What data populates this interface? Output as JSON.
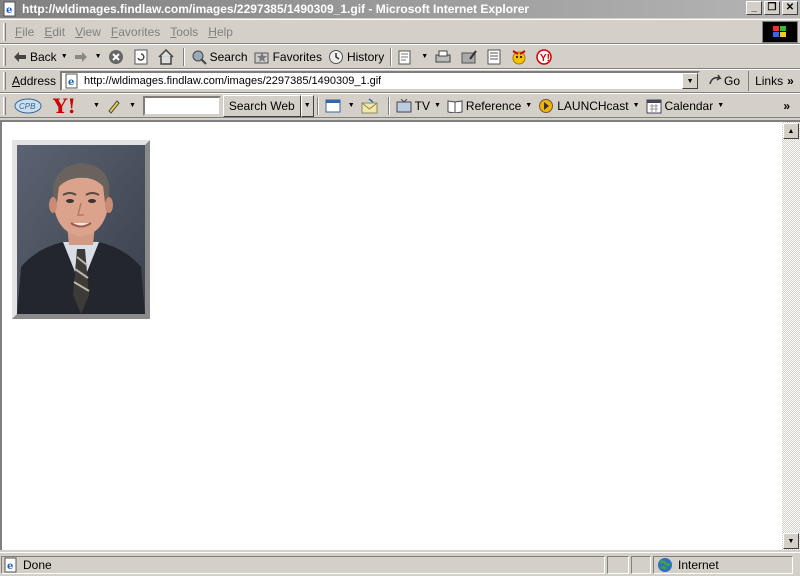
{
  "window": {
    "title": "http://wldimages.findlaw.com/images/2297385/1490309_1.gif - Microsoft Internet Explorer",
    "minimize": "_",
    "maximize": "❐",
    "close": "✕"
  },
  "menu": {
    "items": [
      "File",
      "Edit",
      "View",
      "Favorites",
      "Tools",
      "Help"
    ]
  },
  "toolbar": {
    "back": "Back",
    "search": "Search",
    "favorites": "Favorites",
    "history": "History"
  },
  "address": {
    "label": "Address",
    "url": "http://wldimages.findlaw.com/images/2297385/1490309_1.gif",
    "go": "Go",
    "links": "Links",
    "more": "»"
  },
  "yahoo": {
    "search_button": "Search Web",
    "tv": "TV",
    "reference": "Reference",
    "launchcast": "LAUNCHcast",
    "calendar": "Calendar",
    "more": "»"
  },
  "status": {
    "text": "Done",
    "zone": "Internet"
  },
  "colors": {
    "titlebar_start": "#808080",
    "titlebar_end": "#b5b5b5",
    "chrome": "#d4d0c8",
    "content": "#ffffff",
    "yahoo_red": "#cc0000"
  }
}
